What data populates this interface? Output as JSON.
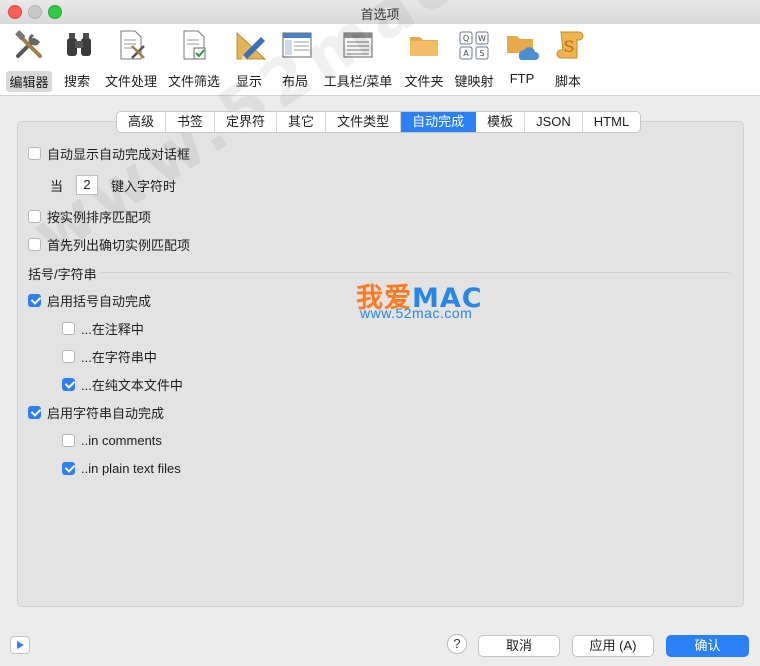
{
  "window": {
    "title": "首选项"
  },
  "toolbar": {
    "items": [
      {
        "label": "编辑器",
        "icon": "tools-icon"
      },
      {
        "label": "搜索",
        "icon": "binoculars-icon"
      },
      {
        "label": "文件处理",
        "icon": "file-tools-icon"
      },
      {
        "label": "文件筛选",
        "icon": "file-check-icon"
      },
      {
        "label": "显示",
        "icon": "pencil-ruler-icon"
      },
      {
        "label": "布局",
        "icon": "window-layout-icon"
      },
      {
        "label": "工具栏/菜单",
        "icon": "toolbar-menu-icon"
      },
      {
        "label": "文件夹",
        "icon": "folder-icon"
      },
      {
        "label": "键映射",
        "icon": "keyboard-icon"
      },
      {
        "label": "FTP",
        "icon": "ftp-icon"
      },
      {
        "label": "脚本",
        "icon": "scroll-icon"
      }
    ]
  },
  "tabs": [
    {
      "label": "高级"
    },
    {
      "label": "书签"
    },
    {
      "label": "定界符"
    },
    {
      "label": "其它"
    },
    {
      "label": "文件类型"
    },
    {
      "label": "自动完成",
      "selected": true
    },
    {
      "label": "模板"
    },
    {
      "label": "JSON"
    },
    {
      "label": "HTML"
    }
  ],
  "options": {
    "show_dialog": {
      "label": "自动显示自动完成对话框",
      "checked": false
    },
    "when_label": "当",
    "char_count": "2",
    "chars_label": "键入字符时",
    "sort_by_instance": {
      "label": "按实例排序匹配项",
      "checked": false
    },
    "exact_first": {
      "label": "首先列出确切实例匹配项",
      "checked": false
    }
  },
  "brackets": {
    "section_title": "括号/字符串",
    "enable_bracket": {
      "label": "启用括号自动完成",
      "checked": true
    },
    "in_comments": {
      "label": "...在注释中",
      "checked": false
    },
    "in_strings": {
      "label": "...在字符串中",
      "checked": false
    },
    "in_plain": {
      "label": "...在纯文本文件中",
      "checked": true
    },
    "enable_string": {
      "label": "启用字符串自动完成",
      "checked": true
    },
    "str_in_comments": {
      "label": "..in comments",
      "checked": false
    },
    "str_in_plain": {
      "label": "..in plain text files",
      "checked": true
    }
  },
  "watermark": {
    "brand_cn": "我爱",
    "brand_en": "MAC",
    "url": "www.52mac.com",
    "diag": "www.52mac.com"
  },
  "footer": {
    "help": "?",
    "cancel": "取消",
    "apply": "应用 (A)",
    "ok": "确认"
  },
  "colors": {
    "accent": "#2b80f6",
    "brand_orange": "#ff7a20",
    "brand_blue": "#2687e6"
  }
}
